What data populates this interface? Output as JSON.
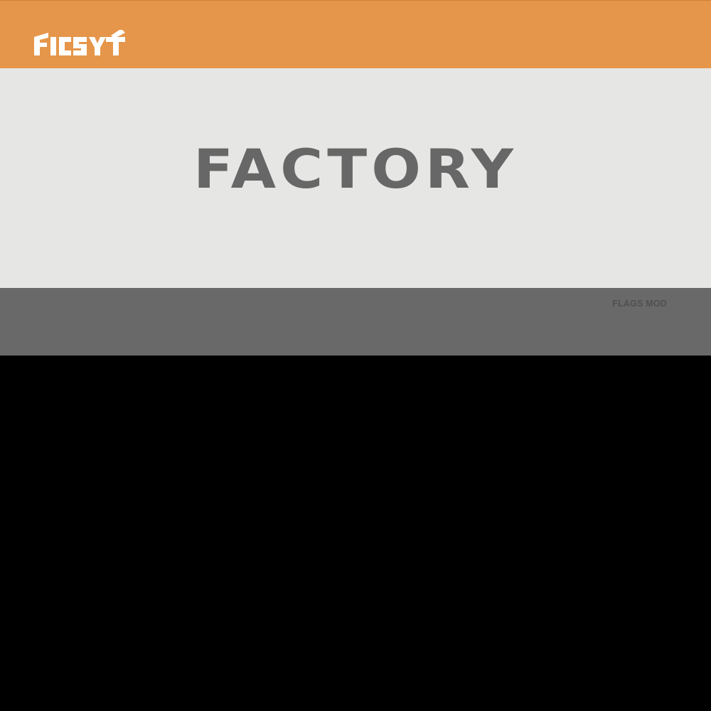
{
  "header": {
    "logo_text": "FICSIT",
    "logo_icon": "ficsit-logo"
  },
  "hero": {
    "title": "FACTORY"
  },
  "footer_band": {
    "tag": "FLAGS MOD"
  },
  "colors": {
    "banner": "#E6964A",
    "hero_background": "#E6E6E4",
    "title_text": "#676767",
    "band": "#696969",
    "tag_text": "#505050",
    "bottom": "#000000",
    "logo": "#FFFFFF"
  }
}
